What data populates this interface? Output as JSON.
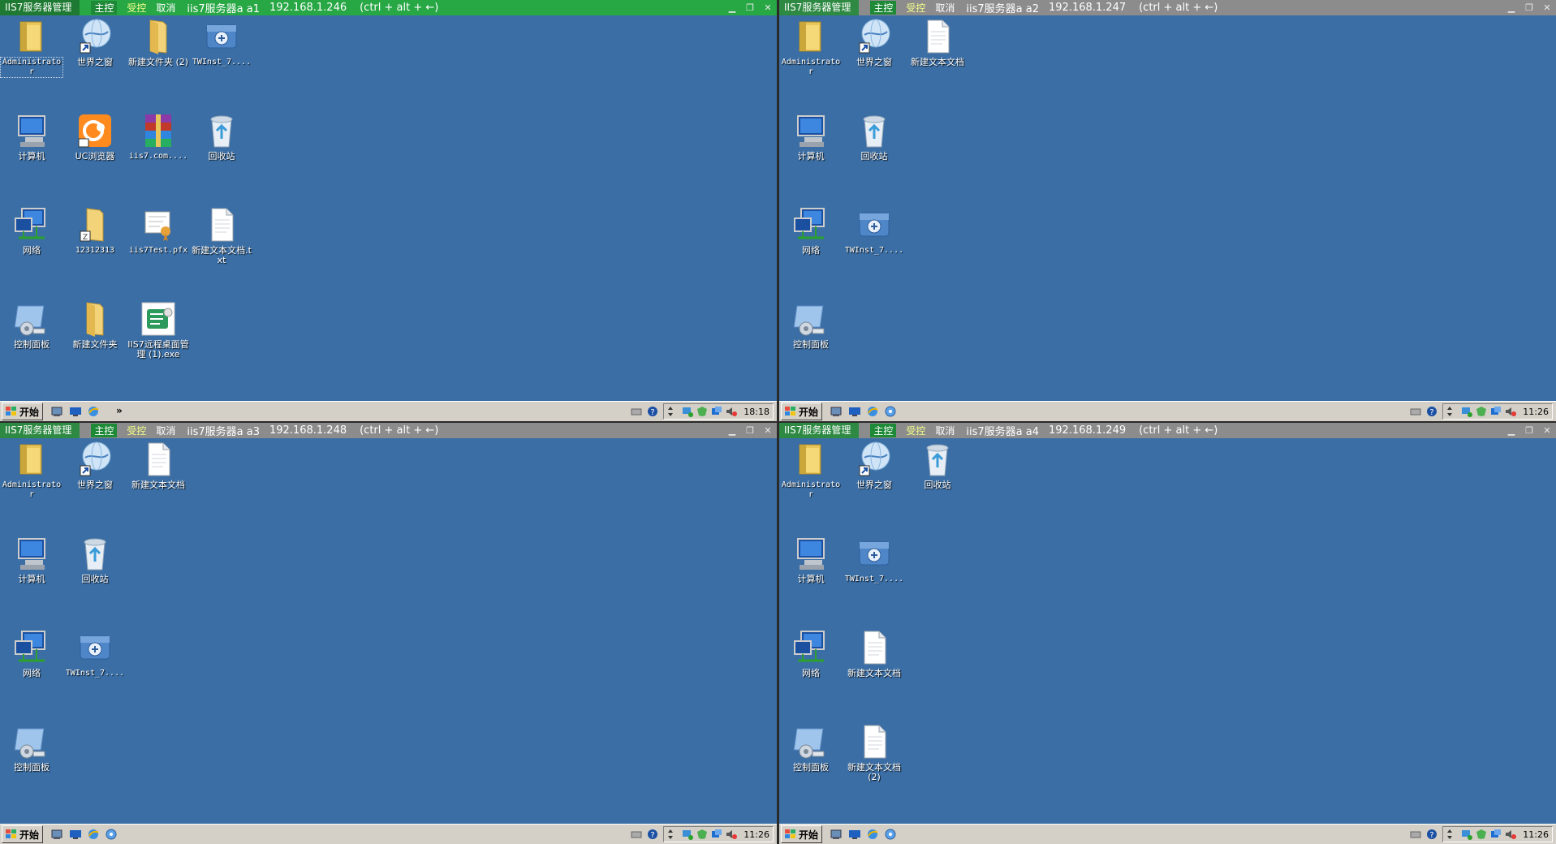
{
  "brand": "IIS7服务器管理",
  "actions": {
    "host": "主控",
    "controlled": "受控",
    "cancel": "取消"
  },
  "hint": "(ctrl + alt + ←)",
  "start_label": "开始",
  "window_buttons": {
    "minimize": "▁",
    "restore": "❐",
    "close": "✕"
  },
  "panes": [
    {
      "name": "iis7服务器a   a1",
      "ip": "192.168.1.246",
      "clock": "18:18",
      "icons": [
        {
          "label": "Administrato r",
          "icon": "user-folder-icon"
        },
        {
          "label": "世界之窗",
          "icon": "browser-globe-icon"
        },
        {
          "label": "新建文件夹 (2)",
          "icon": "folder-icon"
        },
        {
          "label": "TWInst_7....",
          "icon": "installer-icon"
        },
        {
          "label": "计算机",
          "icon": "computer-icon"
        },
        {
          "label": "UC浏览器",
          "icon": "uc-browser-icon"
        },
        {
          "label": "iis7.com....",
          "icon": "winrar-icon"
        },
        {
          "label": "回收站",
          "icon": "recycle-bin-icon"
        },
        {
          "label": "网络",
          "icon": "network-icon"
        },
        {
          "label": "12312313",
          "icon": "zip-folder-icon"
        },
        {
          "label": "iis7Test.pfx",
          "icon": "certificate-icon"
        },
        {
          "label": "新建文本文档.txt",
          "icon": "text-file-icon"
        },
        {
          "label": "控制面板",
          "icon": "control-panel-icon"
        },
        {
          "label": "新建文件夹",
          "icon": "folder-icon"
        },
        {
          "label": "IIS7远程桌面管理 (1).exe",
          "icon": "iis7-exe-icon"
        }
      ]
    },
    {
      "name": "iis7服务器a   a2",
      "ip": "192.168.1.247",
      "clock": "11:26",
      "icons": [
        {
          "label": "Administrato r",
          "icon": "user-folder-icon"
        },
        {
          "label": "世界之窗",
          "icon": "browser-globe-icon"
        },
        {
          "label": "新建文本文档",
          "icon": "text-file-icon"
        },
        {
          "label": "计算机",
          "icon": "computer-icon"
        },
        {
          "label": "回收站",
          "icon": "recycle-bin-icon"
        },
        {
          "label": "网络",
          "icon": "network-icon"
        },
        {
          "label": "TWInst_7....",
          "icon": "installer-icon"
        },
        {
          "label": "控制面板",
          "icon": "control-panel-icon"
        }
      ]
    },
    {
      "name": "iis7服务器a   a3",
      "ip": "192.168.1.248",
      "clock": "11:26",
      "icons": [
        {
          "label": "Administrato r",
          "icon": "user-folder-icon"
        },
        {
          "label": "世界之窗",
          "icon": "browser-globe-icon"
        },
        {
          "label": "新建文本文档",
          "icon": "text-file-icon"
        },
        {
          "label": "计算机",
          "icon": "computer-icon"
        },
        {
          "label": "回收站",
          "icon": "recycle-bin-icon"
        },
        {
          "label": "网络",
          "icon": "network-icon"
        },
        {
          "label": "TWInst_7....",
          "icon": "installer-icon"
        },
        {
          "label": "控制面板",
          "icon": "control-panel-icon"
        }
      ]
    },
    {
      "name": "iis7服务器a   a4",
      "ip": "192.168.1.249",
      "clock": "11:26",
      "icons": [
        {
          "label": "Administrato r",
          "icon": "user-folder-icon"
        },
        {
          "label": "世界之窗",
          "icon": "browser-globe-icon"
        },
        {
          "label": "回收站",
          "icon": "recycle-bin-icon"
        },
        {
          "label": "计算机",
          "icon": "computer-icon"
        },
        {
          "label": "TWInst_7....",
          "icon": "installer-icon"
        },
        {
          "label": "网络",
          "icon": "network-icon"
        },
        {
          "label": "新建文本文档",
          "icon": "text-file-icon"
        },
        {
          "label": "控制面板",
          "icon": "control-panel-icon"
        },
        {
          "label": "新建文本文档 (2)",
          "icon": "text-file-icon"
        }
      ]
    }
  ]
}
